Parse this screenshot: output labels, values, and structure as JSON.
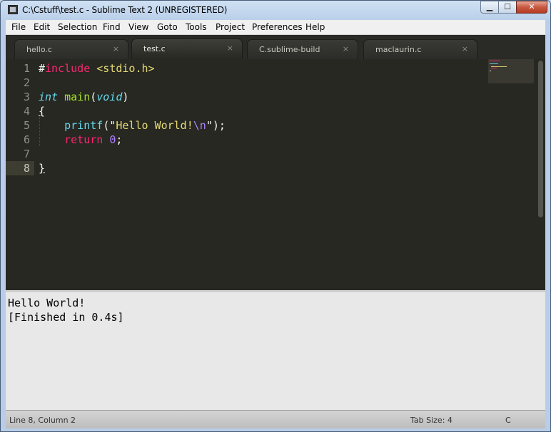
{
  "window": {
    "title": "C:\\Cstuff\\test.c - Sublime Text 2 (UNREGISTERED)",
    "minimize_icon": "minimize-icon",
    "maximize_icon": "maximize-icon",
    "close_icon": "close-icon"
  },
  "menu": [
    "File",
    "Edit",
    "Selection",
    "Find",
    "View",
    "Goto",
    "Tools",
    "Project",
    "Preferences",
    "Help"
  ],
  "tabs": [
    {
      "label": "hello.c",
      "close": "×"
    },
    {
      "label": "test.c",
      "close": "×"
    },
    {
      "label": "C.sublime-build",
      "close": "×"
    },
    {
      "label": "maclaurin.c",
      "close": "×"
    }
  ],
  "line_numbers": [
    "1",
    "2",
    "3",
    "4",
    "5",
    "6",
    "7",
    "8"
  ],
  "code": {
    "l1": {
      "hash": "#",
      "include": "include",
      "header": "<stdio.h>"
    },
    "l3": {
      "type": "int",
      "fn": "main",
      "open": "(",
      "param": "void",
      "close": ")"
    },
    "l4": {
      "brace": "{"
    },
    "l5": {
      "indent": "    ",
      "fn": "printf",
      "open": "(\"",
      "str": "Hello World!",
      "esc": "\\n",
      "close": "\");"
    },
    "l6": {
      "indent": "    ",
      "kw": "return",
      "sp": " ",
      "num": "0",
      "semi": ";"
    },
    "l8": {
      "brace": "}"
    }
  },
  "output": {
    "line1": "Hello World!",
    "line2": "[Finished in 0.4s]"
  },
  "status": {
    "position": "Line 8, Column 2",
    "tab_size": "Tab Size: 4",
    "syntax": "C"
  },
  "colors": {
    "editor_bg": "#272822",
    "keyword": "#f92672",
    "type": "#66d9ef",
    "function": "#a6e22e",
    "string": "#e6db74",
    "number": "#ae81ff"
  }
}
